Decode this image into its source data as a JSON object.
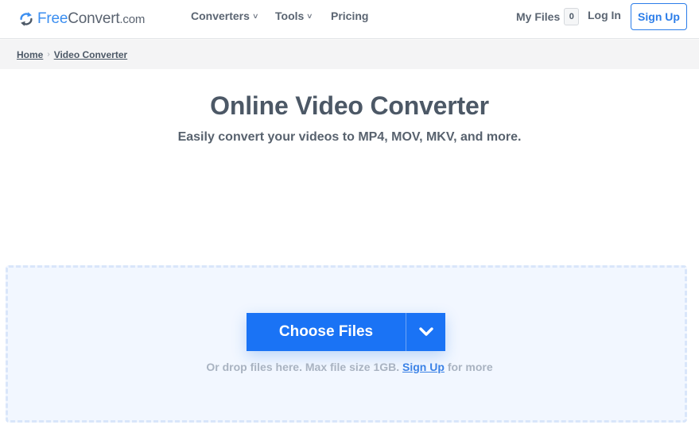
{
  "header": {
    "logo": {
      "part1": "Free",
      "part2": "Convert",
      "part3": ".com",
      "icon": "refresh-arrows-icon"
    },
    "nav": [
      {
        "label": "Converters",
        "has_caret": true
      },
      {
        "label": "Tools",
        "has_caret": true
      },
      {
        "label": "Pricing",
        "has_caret": false
      }
    ],
    "caret_glyph": "∨",
    "my_files_label": "My Files",
    "my_files_count": "0",
    "login_label": "Log In",
    "signup_label": "Sign Up"
  },
  "breadcrumb": {
    "items": [
      "Home",
      "Video Converter"
    ],
    "separator": "›"
  },
  "hero": {
    "title": "Online Video Converter",
    "subtitle": "Easily convert your videos to MP4, MOV, MKV, and more."
  },
  "dropzone": {
    "choose_label": "Choose Files",
    "dropdown_icon": "chevron-down-icon",
    "hint_prefix": "Or drop files here. Max file size 1GB.",
    "hint_link": "Sign Up",
    "hint_suffix": "for more"
  },
  "colors": {
    "brand_blue": "#1a73f5",
    "link_blue": "#2b7de9",
    "text_dark": "#4c5866",
    "dropzone_bg": "#f2f7ff"
  }
}
